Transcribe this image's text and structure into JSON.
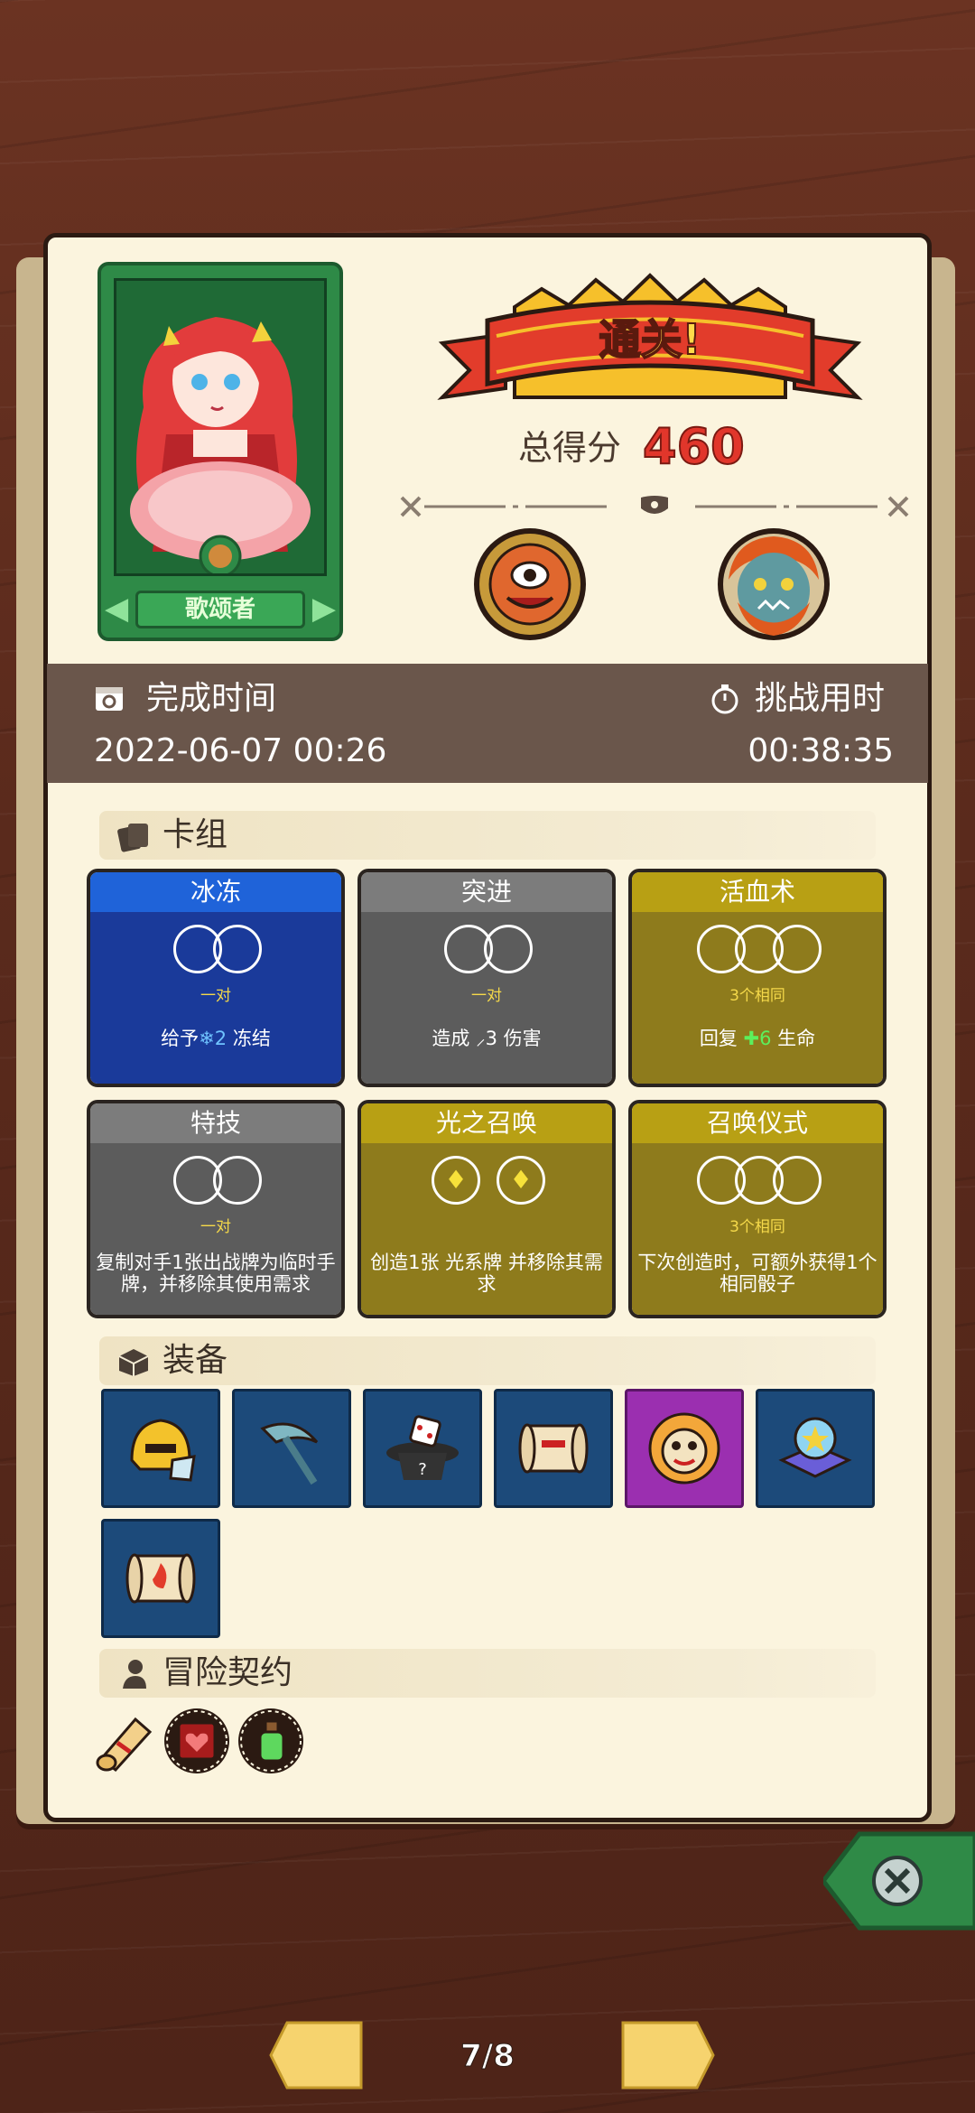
{
  "hero": {
    "name": "歌颂者"
  },
  "result": {
    "banner_text": "通关!",
    "score_label": "总得分",
    "score_value": "460"
  },
  "time": {
    "completion_label": "完成时间",
    "completion_value": "2022-06-07 00:26",
    "duration_label": "挑战用时",
    "duration_value": "00:38:35"
  },
  "deck": {
    "title": "卡组",
    "cards": [
      {
        "name": "冰冻",
        "sub": "一对",
        "desc_pre": "给予",
        "desc_num": "2",
        "desc_post": "冻结",
        "style": "blue"
      },
      {
        "name": "突进",
        "sub": "一对",
        "desc_pre": "造成 ",
        "desc_num": "3",
        "desc_post": "伤害",
        "style": "gray"
      },
      {
        "name": "活血术",
        "sub": "3个相同",
        "desc_pre": "回复 ",
        "desc_num": "6",
        "desc_post": "生命",
        "style": "gold"
      },
      {
        "name": "特技",
        "sub": "一对",
        "desc": "复制对手1张出战牌为临时手牌，并移除其使用需求",
        "style": "gray"
      },
      {
        "name": "光之召唤",
        "sub": "",
        "desc": "创造1张 光系牌 并移除其需求",
        "style": "gold"
      },
      {
        "name": "召唤仪式",
        "sub": "3个相同",
        "desc": "下次创造时，可额外获得1个相同骰子",
        "style": "gold"
      }
    ]
  },
  "equipment": {
    "title": "装备",
    "items": [
      "golden-helmet-icon",
      "scythe-icon",
      "magic-hat-dice-icon",
      "scroll-red-seal-icon",
      "demon-mask-icon",
      "crystal-star-icon",
      "fire-scroll-icon"
    ]
  },
  "contract": {
    "title": "冒险契约",
    "items": [
      "contract-scroll-icon",
      "heart-box-icon",
      "potion-bottle-icon"
    ]
  },
  "pager": {
    "text": "7/8"
  }
}
